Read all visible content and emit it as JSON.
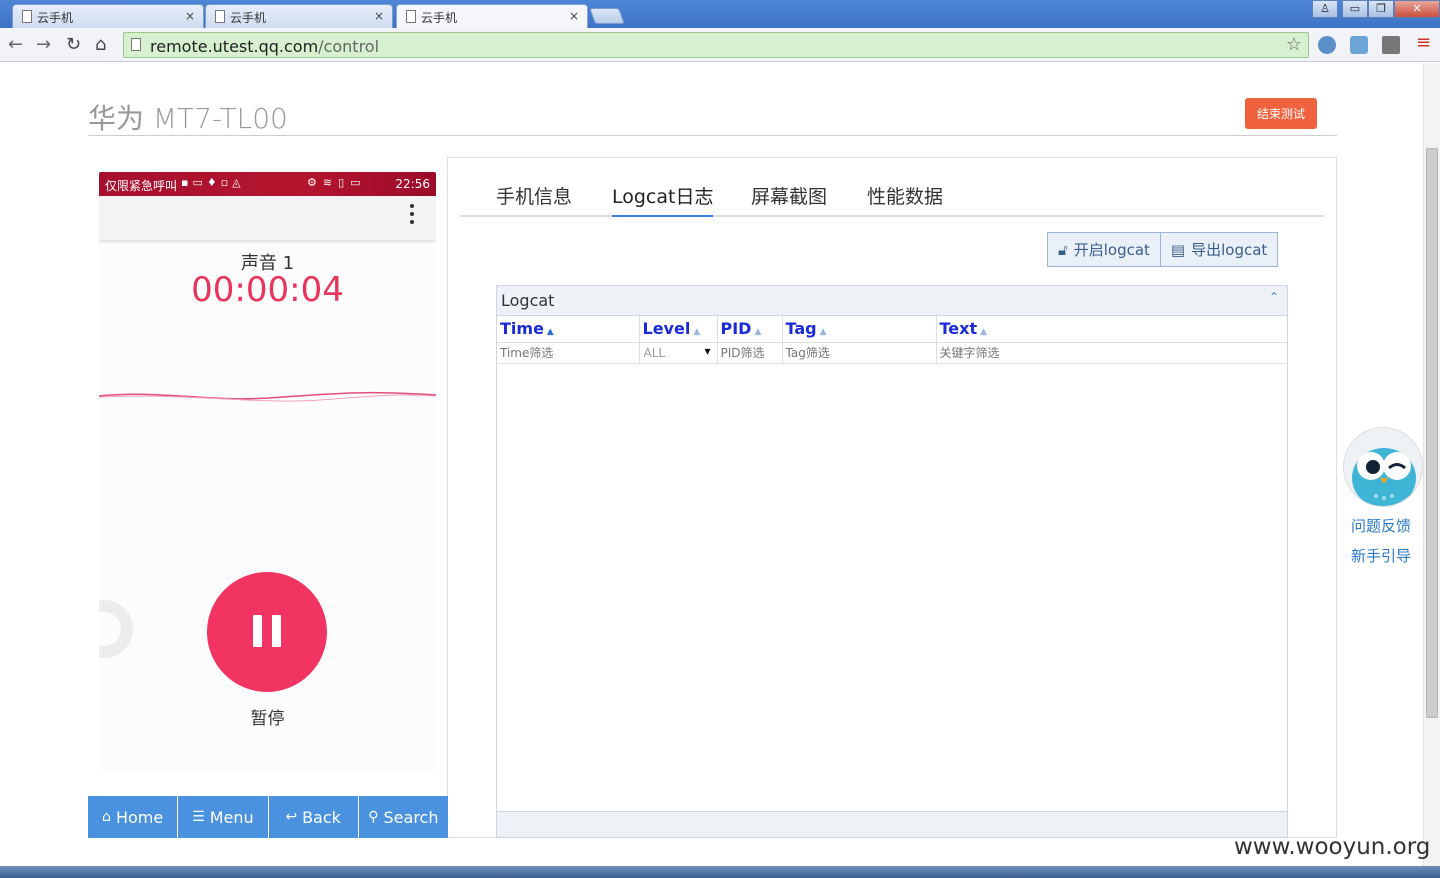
{
  "browser": {
    "tabs": [
      {
        "title": "云手机",
        "active": false
      },
      {
        "title": "云手机",
        "active": false
      },
      {
        "title": "云手机",
        "active": true
      }
    ],
    "close_glyph": "×",
    "url_host": "remote.utest.qq.com",
    "url_path": "/control"
  },
  "page": {
    "title": "华为 MT7-TL00",
    "end_button": "结束测试"
  },
  "phone": {
    "status_left": "仅限紧急呼叫",
    "status_time": "22:56",
    "recording_name": "声音 1",
    "recording_time": "00:00:04",
    "pause_label": "暂停",
    "nav": [
      {
        "label": "Home",
        "icon": "home-icon",
        "glyph": "⌂"
      },
      {
        "label": "Menu",
        "icon": "menu-icon",
        "glyph": "☰"
      },
      {
        "label": "Back",
        "icon": "back-icon",
        "glyph": "↩"
      },
      {
        "label": "Search",
        "icon": "search-icon",
        "glyph": "⚲"
      }
    ]
  },
  "panel": {
    "tabs": [
      "手机信息",
      "Logcat日志",
      "屏幕截图",
      "性能数据"
    ],
    "active_tab": 1,
    "buttons": {
      "open": "开启logcat",
      "export": "导出logcat"
    },
    "logcat": {
      "title": "Logcat",
      "columns": [
        "Time",
        "Level",
        "PID",
        "Tag",
        "Text"
      ],
      "filters": {
        "time": "Time筛选",
        "level": "ALL",
        "pid": "PID筛选",
        "tag": "Tag筛选",
        "text": "关键字筛选"
      }
    }
  },
  "help": {
    "feedback": "问题反馈",
    "guide": "新手引导"
  },
  "watermark": "www.wooyun.org",
  "colors": {
    "accent": "#3b7dd8",
    "end_button": "#f0623e",
    "record_red": "#f23462",
    "nav_blue": "#4a92e0",
    "status_bar": "#a50f2e"
  }
}
